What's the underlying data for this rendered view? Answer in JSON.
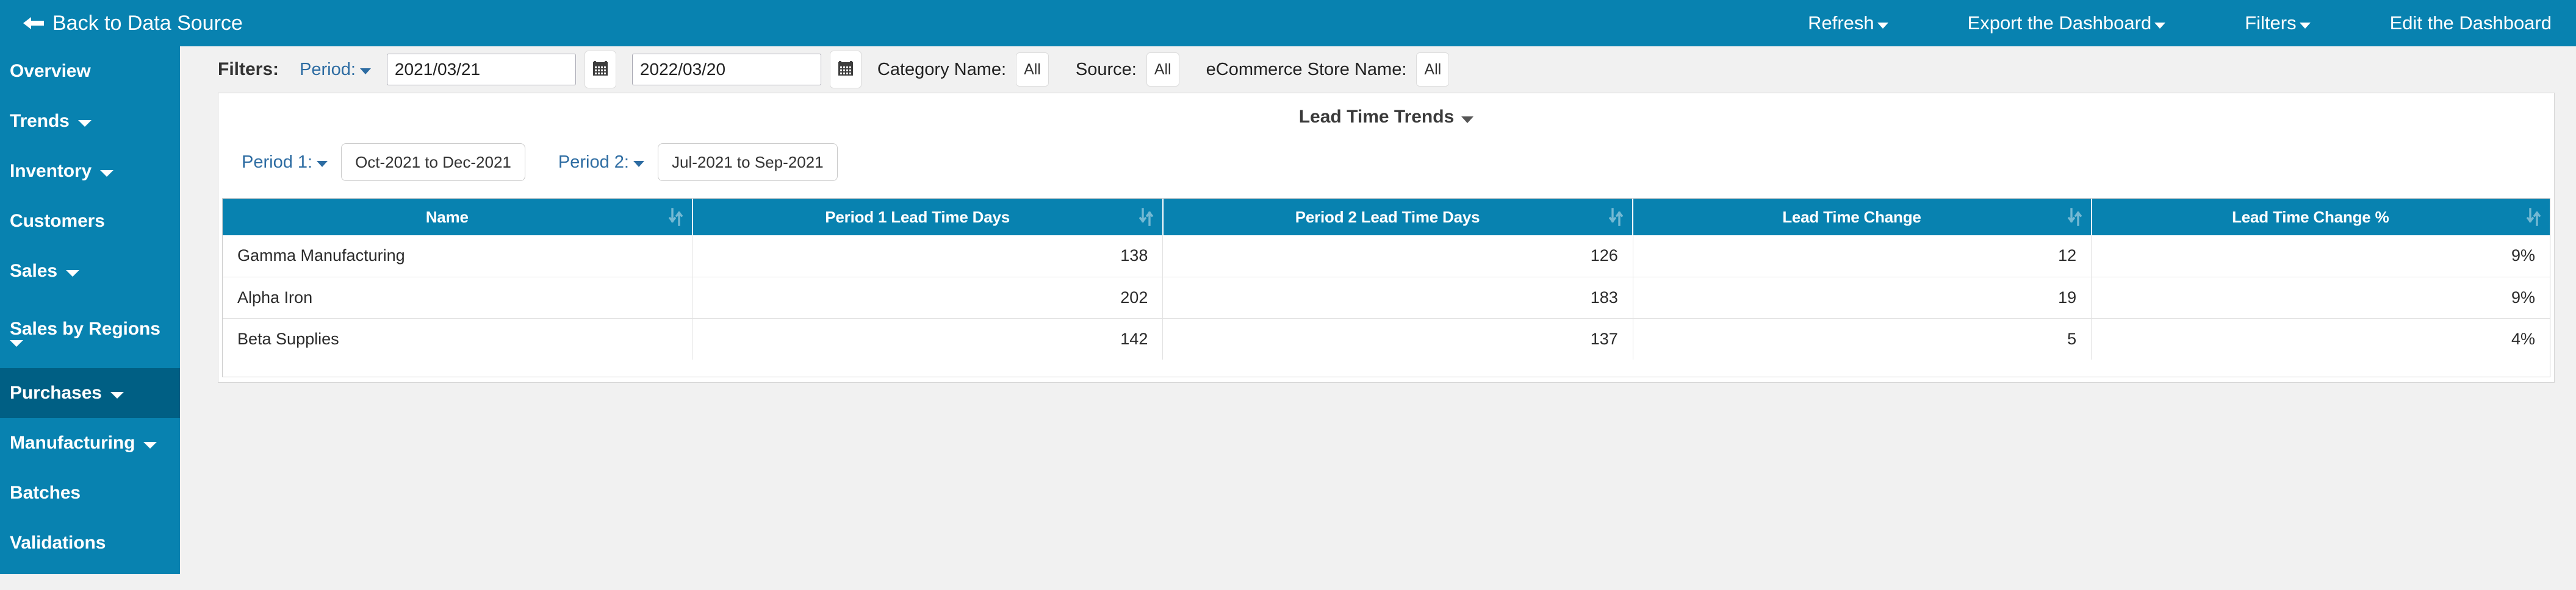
{
  "topbar": {
    "back_label": "Back to Data Source",
    "back_icon": "arrow-left-icon",
    "nav": [
      {
        "label": "Refresh",
        "has_caret": true
      },
      {
        "label": "Export the Dashboard",
        "has_caret": true
      },
      {
        "label": "Filters",
        "has_caret": true
      },
      {
        "label": "Edit the Dashboard",
        "has_caret": false
      }
    ]
  },
  "sidebar": {
    "items": [
      {
        "label": "Overview",
        "caret": false,
        "active": false
      },
      {
        "label": "Trends",
        "caret": true,
        "active": false
      },
      {
        "label": "Inventory",
        "caret": true,
        "active": false
      },
      {
        "label": "Customers",
        "caret": false,
        "active": false
      },
      {
        "label": "Sales",
        "caret": true,
        "active": false
      },
      {
        "label": "Sales by Regions",
        "caret": true,
        "active": false
      },
      {
        "label": "Purchases",
        "caret": true,
        "active": true
      },
      {
        "label": "Manufacturing",
        "caret": true,
        "active": false
      },
      {
        "label": "Batches",
        "caret": false,
        "active": false
      },
      {
        "label": "Validations",
        "caret": false,
        "active": false
      }
    ]
  },
  "filterbar": {
    "filters_label": "Filters:",
    "period_label": "Period:",
    "date_from": "2021/03/21",
    "date_to": "2022/03/20",
    "calendar_icon": "calendar-icon",
    "category_name_label": "Category Name:",
    "category_name_value": "All",
    "source_label": "Source:",
    "source_value": "All",
    "ecommerce_store_label": "eCommerce Store Name:",
    "ecommerce_store_value": "All"
  },
  "card": {
    "title": "Lead Time Trends",
    "period1_label": "Period 1:",
    "period1_value": "Oct-2021 to Dec-2021",
    "period2_label": "Period 2:",
    "period2_value": "Jul-2021 to Sep-2021"
  },
  "table": {
    "columns": [
      "Name",
      "Period 1 Lead Time Days",
      "Period 2 Lead Time Days",
      "Lead Time Change",
      "Lead Time Change %"
    ],
    "sort_icon": "sort-updown-icon",
    "rows": [
      {
        "name": "Gamma Manufacturing",
        "p1": "138",
        "p2": "126",
        "change": "12",
        "change_pct": "9%"
      },
      {
        "name": "Alpha Iron",
        "p1": "202",
        "p2": "183",
        "change": "19",
        "change_pct": "9%"
      },
      {
        "name": "Beta Supplies",
        "p1": "142",
        "p2": "137",
        "change": "5",
        "change_pct": "4%"
      }
    ]
  },
  "colors": {
    "brand": "#0882b0",
    "brand_active": "#005f84",
    "page_bg": "#f1f1f1",
    "link": "#2d6ca2",
    "card_bg": "#ffffff"
  }
}
